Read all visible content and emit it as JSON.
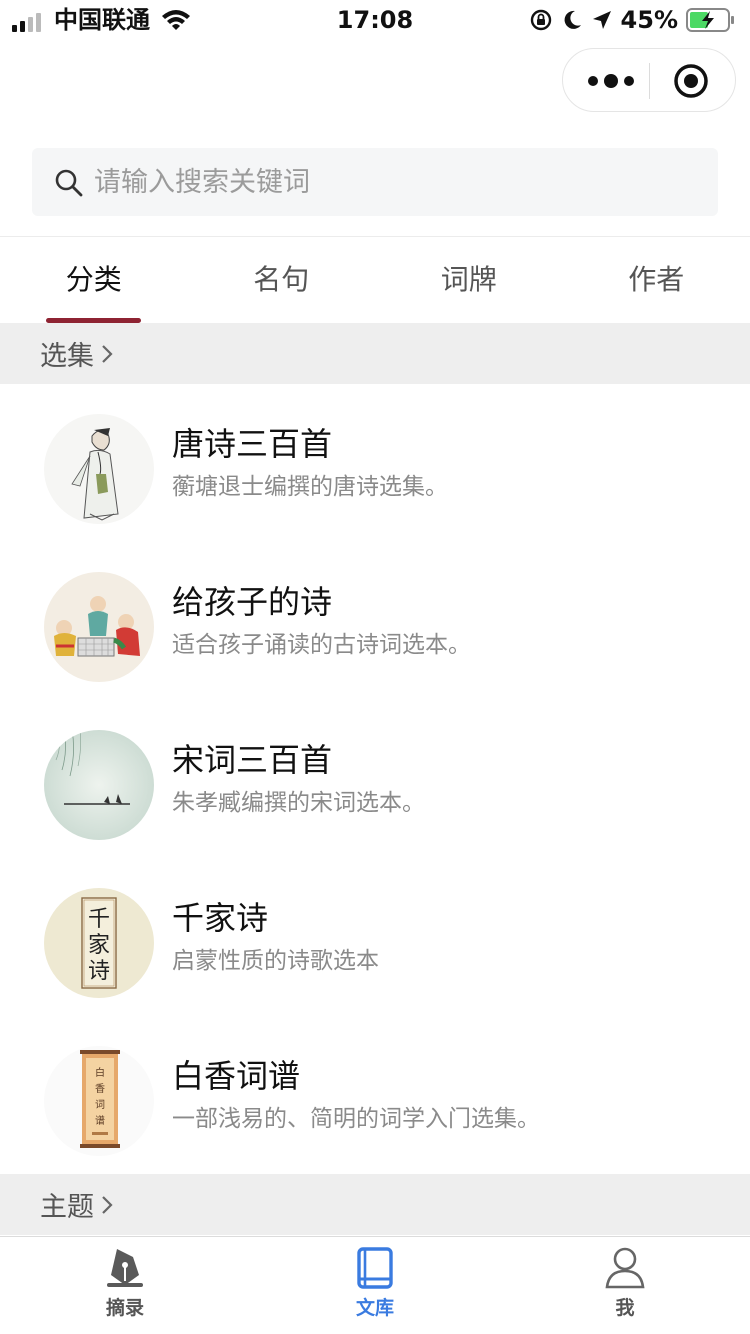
{
  "status_bar": {
    "carrier": "中国联通",
    "time": "17:08",
    "battery": "45%"
  },
  "capsule": {
    "more_icon": "more-dots-icon",
    "close_icon": "target-circle-icon"
  },
  "search": {
    "placeholder": "请输入搜索关键词",
    "icon": "search-icon"
  },
  "tabs": [
    {
      "label": "分类",
      "active": true
    },
    {
      "label": "名句",
      "active": false
    },
    {
      "label": "词牌",
      "active": false
    },
    {
      "label": "作者",
      "active": false
    }
  ],
  "sections": {
    "collections": {
      "label": "选集"
    },
    "themes": {
      "label": "主题"
    }
  },
  "collections": [
    {
      "title": "唐诗三百首",
      "desc": "蘅塘退士编撰的唐诗选集。",
      "image": "poet-figure-painting"
    },
    {
      "title": "给孩子的诗",
      "desc": "适合孩子诵读的古诗词选本。",
      "image": "children-playing-painting"
    },
    {
      "title": "宋词三百首",
      "desc": "朱孝臧编撰的宋词选本。",
      "image": "willow-river-painting"
    },
    {
      "title": "千家诗",
      "desc": "启蒙性质的诗歌选本",
      "image": "calligraphy-scroll",
      "image_text": "千家诗"
    },
    {
      "title": "白香词谱",
      "desc": "一部浅易的、简明的词学入门选集。",
      "image": "book-cover-scroll",
      "image_text": "白香词谱"
    }
  ],
  "tabbar": [
    {
      "label": "摘录",
      "icon": "pen-nib-icon",
      "active": false
    },
    {
      "label": "文库",
      "icon": "book-icon",
      "active": true
    },
    {
      "label": "我",
      "icon": "user-icon",
      "active": false
    }
  ],
  "colors": {
    "accent": "#8e2332",
    "tabbar_active": "#3a7be0",
    "section_bg": "#eeeeee"
  }
}
